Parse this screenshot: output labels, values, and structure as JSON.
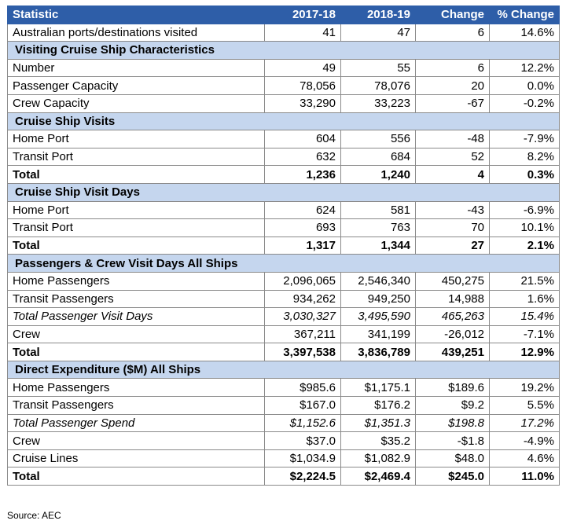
{
  "table": {
    "columns": [
      "Statistic",
      "2017-18",
      "2018-19",
      "Change",
      "% Change"
    ],
    "rows": [
      {
        "type": "data",
        "cells": [
          "Australian ports/destinations visited",
          "41",
          "47",
          "6",
          "14.6%"
        ]
      },
      {
        "type": "section",
        "cells": [
          "Visiting Cruise Ship Characteristics"
        ]
      },
      {
        "type": "data",
        "cells": [
          "Number",
          "49",
          "55",
          "6",
          "12.2%"
        ]
      },
      {
        "type": "data",
        "cells": [
          "Passenger Capacity",
          "78,056",
          "78,076",
          "20",
          "0.0%"
        ]
      },
      {
        "type": "data",
        "cells": [
          "Crew Capacity",
          "33,290",
          "33,223",
          "-67",
          "-0.2%"
        ]
      },
      {
        "type": "section",
        "cells": [
          "Cruise Ship Visits"
        ]
      },
      {
        "type": "data",
        "cells": [
          "Home Port",
          "604",
          "556",
          "-48",
          "-7.9%"
        ]
      },
      {
        "type": "data",
        "cells": [
          "Transit Port",
          "632",
          "684",
          "52",
          "8.2%"
        ]
      },
      {
        "type": "total",
        "cells": [
          "Total",
          "1,236",
          "1,240",
          "4",
          "0.3%"
        ]
      },
      {
        "type": "section",
        "cells": [
          "Cruise Ship Visit Days"
        ]
      },
      {
        "type": "data",
        "cells": [
          "Home Port",
          "624",
          "581",
          "-43",
          "-6.9%"
        ]
      },
      {
        "type": "data",
        "cells": [
          "Transit Port",
          "693",
          "763",
          "70",
          "10.1%"
        ]
      },
      {
        "type": "total",
        "cells": [
          "Total",
          "1,317",
          "1,344",
          "27",
          "2.1%"
        ]
      },
      {
        "type": "section",
        "cells": [
          "Passengers & Crew Visit Days All Ships"
        ]
      },
      {
        "type": "data",
        "cells": [
          "Home Passengers",
          "2,096,065",
          "2,546,340",
          "450,275",
          "21.5%"
        ]
      },
      {
        "type": "data",
        "cells": [
          "Transit Passengers",
          "934,262",
          "949,250",
          "14,988",
          "1.6%"
        ]
      },
      {
        "type": "italic",
        "cells": [
          "Total Passenger Visit Days",
          "3,030,327",
          "3,495,590",
          "465,263",
          "15.4%"
        ]
      },
      {
        "type": "data",
        "cells": [
          "Crew",
          "367,211",
          "341,199",
          "-26,012",
          "-7.1%"
        ]
      },
      {
        "type": "total",
        "cells": [
          "Total",
          "3,397,538",
          "3,836,789",
          "439,251",
          "12.9%"
        ]
      },
      {
        "type": "section",
        "cells": [
          "Direct Expenditure ($M) All Ships"
        ]
      },
      {
        "type": "data",
        "cells": [
          "Home Passengers",
          "$985.6",
          "$1,175.1",
          "$189.6",
          "19.2%"
        ]
      },
      {
        "type": "data",
        "cells": [
          "Transit Passengers",
          "$167.0",
          "$176.2",
          "$9.2",
          "5.5%"
        ]
      },
      {
        "type": "italic",
        "cells": [
          "Total Passenger Spend",
          "$1,152.6",
          "$1,351.3",
          "$198.8",
          "17.2%"
        ]
      },
      {
        "type": "data",
        "cells": [
          "Crew",
          "$37.0",
          "$35.2",
          "-$1.8",
          "-4.9%"
        ]
      },
      {
        "type": "data",
        "cells": [
          "Cruise Lines",
          "$1,034.9",
          "$1,082.9",
          "$48.0",
          "4.6%"
        ]
      },
      {
        "type": "total",
        "cells": [
          "Total",
          "$2,224.5",
          "$2,469.4",
          "$245.0",
          "11.0%"
        ]
      }
    ]
  },
  "source": "Source: AEC",
  "colors": {
    "header_bg": "#2e5ea8",
    "section_bg": "#c5d6ee",
    "border": "#8a8a8a"
  }
}
